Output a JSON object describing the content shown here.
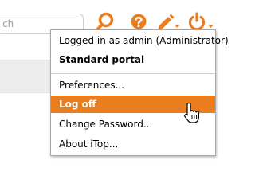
{
  "search": {
    "visible_value": "ch",
    "icon": "search-icon"
  },
  "toolbar": {
    "help_icon": "help-icon",
    "tools_icon": "pencil-icon",
    "power_icon": "power-icon",
    "accent_color": "#ea7d1e"
  },
  "user_menu": {
    "logged_in_text": "Logged in as admin (Administrator)",
    "items": [
      {
        "label": "Standard portal"
      },
      {
        "label": "Preferences..."
      },
      {
        "label": "Log off",
        "active": true
      },
      {
        "label": "Change Password..."
      },
      {
        "label": "About iTop..."
      }
    ],
    "highlight_color": "#ea7d1e"
  },
  "cursor": {
    "icon": "hand-pointer-icon"
  }
}
